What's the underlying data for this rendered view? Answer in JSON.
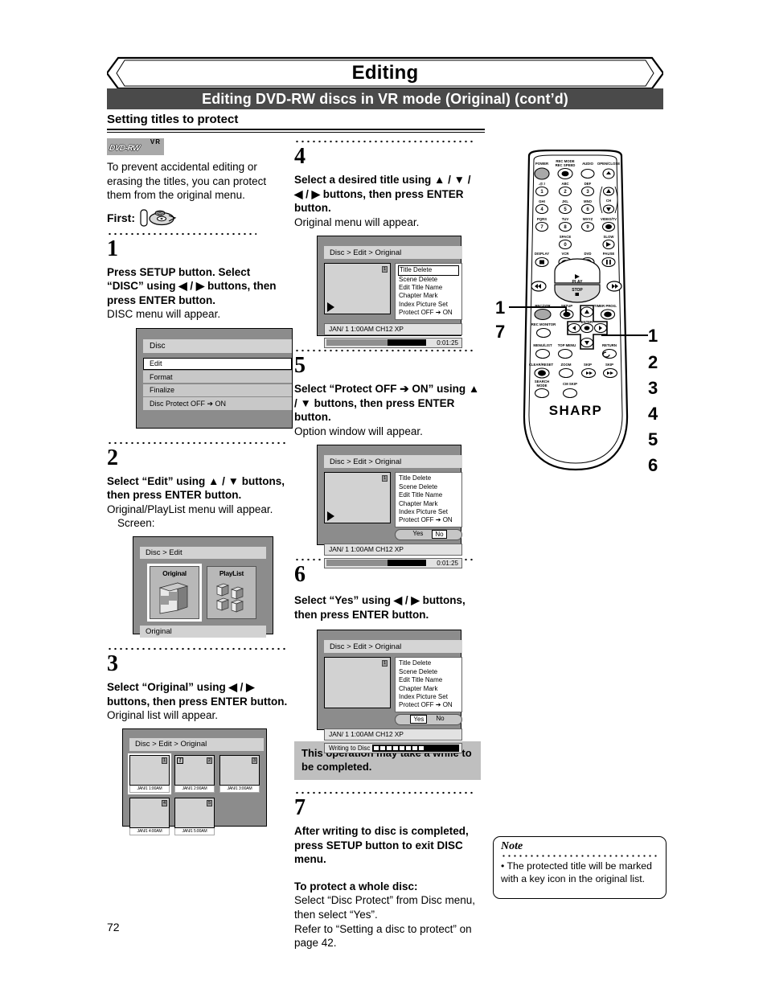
{
  "header": {
    "banner_title": "Editing",
    "sub_banner": "Editing DVD-RW discs in VR mode (Original) (cont’d)",
    "section_title": "Setting titles to protect"
  },
  "page_number": "72",
  "logo": {
    "vr": "VR",
    "disc": "DVD-RW"
  },
  "intro": {
    "paragraph": "To prevent accidental editing or erasing the titles, you can protect them from the original menu.",
    "first_label": "First:",
    "first_icon": "hand-inserting-disc-icon"
  },
  "steps": [
    {
      "number": "1",
      "bold": "Press SETUP button. Select “DISC” using ◀ / ▶ buttons, then press ENTER button.",
      "plain": "DISC menu will appear."
    },
    {
      "number": "2",
      "bold": "Select “Edit” using ▲ / ▼ buttons, then press ENTER button.",
      "plain": "Original/PlayList menu will appear.",
      "plain2": "Screen:"
    },
    {
      "number": "3",
      "bold": "Select “Original” using ◀ / ▶ buttons, then press ENTER button.",
      "plain": "Original list will appear."
    },
    {
      "number": "4",
      "bold": "Select a desired title using ▲ / ▼ / ◀ / ▶ buttons, then press ENTER button.",
      "plain": "Original menu will appear."
    },
    {
      "number": "5",
      "bold": "Select “Protect OFF ➔ ON” using ▲ / ▼ buttons, then press ENTER button.",
      "plain": "Option window will appear."
    },
    {
      "number": "6",
      "bold": "Select “Yes” using ◀ / ▶ buttons, then press ENTER button."
    },
    {
      "number": "7",
      "bold": "After writing to disc is completed, press SETUP button to exit DISC menu."
    }
  ],
  "gray_note": "This operation may take a while to be completed.",
  "whole_disc": {
    "heading": "To protect a whole disc:",
    "body": "Select “Disc Protect” from Disc menu, then select “Yes”.",
    "body2": "Refer to “Setting a disc to protect” on page 42."
  },
  "note": {
    "title": "Note",
    "body": "• The protected title will be marked with a key icon in the original list."
  },
  "disc_menu": {
    "title": "Disc",
    "items": [
      {
        "label": "Edit",
        "selected": true
      },
      {
        "label": "Format",
        "selected": false
      },
      {
        "label": "Finalize",
        "selected": false
      },
      {
        "label": "Disc Protect OFF ➔ ON",
        "selected": false
      }
    ]
  },
  "op_menu": {
    "crumb": "Disc > Edit",
    "cards": [
      {
        "label": "Original",
        "selected": true
      },
      {
        "label": "PlayList",
        "selected": false
      }
    ],
    "footer": "Original"
  },
  "original_list": {
    "crumb": "Disc > Edit > Original",
    "thumbs": [
      {
        "index": "1",
        "label": "JAN/1  1:00AM",
        "selected": true,
        "key": false
      },
      {
        "index": "2",
        "label": "JAN/1  2:00AM",
        "selected": false,
        "key": true
      },
      {
        "index": "3",
        "label": "JAN/1  3:00AM",
        "selected": false,
        "key": false
      },
      {
        "index": "4",
        "label": "JAN/1  4:00AM",
        "selected": false,
        "key": false
      },
      {
        "index": "5",
        "label": "JAN/1  5:00AM",
        "selected": false,
        "key": false
      }
    ]
  },
  "edit_screen": {
    "crumb": "Disc > Edit > Original",
    "thumb_index": "1",
    "options": [
      "Title Delete",
      "Scene Delete",
      "Edit Title Name",
      "Chapter Mark",
      "Index Picture Set",
      "Protect OFF ➔ ON"
    ],
    "info": "JAN/ 1  1:00AM  CH12     XP",
    "time": "0:01:25",
    "yes": "Yes",
    "no": "No",
    "writing": "Writing to Disc"
  },
  "remote": {
    "brand": "SHARP",
    "labels_top": [
      "POWER",
      "REC MODE",
      "REC SPEED",
      "AUDIO",
      "OPEN/CLOSE"
    ],
    "keypad": [
      {
        "letters": ".@:!",
        "digit": "1"
      },
      {
        "letters": "ABC",
        "digit": "2"
      },
      {
        "letters": "DEF",
        "digit": "3"
      },
      {
        "letters": "GHI",
        "digit": "4"
      },
      {
        "letters": "JKL",
        "digit": "5"
      },
      {
        "letters": "MNO",
        "digit": "6"
      },
      {
        "letters": "PQRS",
        "digit": "7"
      },
      {
        "letters": "TUV",
        "digit": "8"
      },
      {
        "letters": "WXYZ",
        "digit": "9"
      },
      {
        "letters": "SPACE",
        "digit": "0"
      }
    ],
    "ch_label": "CH",
    "video_tv": "VIDEO/TV",
    "slow": "SLOW",
    "row_display": [
      "DISPLAY",
      "VCR",
      "DVD",
      "PAUSE"
    ],
    "play": "PLAY",
    "stop": "STOP",
    "row_rec": [
      "REC/OTR",
      "SETUP",
      "TIMER PROG."
    ],
    "row_mon": [
      "REC MONITOR",
      "ENTER",
      "RETURN"
    ],
    "row_menu": [
      "MENU/LIST",
      "TOP MENU"
    ],
    "row_clear": [
      "CLEAR/RESET",
      "ZOOM",
      "SKIP",
      "SKIP"
    ],
    "row_search": [
      "SEARCH MODE",
      "CM SKIP"
    ],
    "callouts_left": [
      "1",
      "7"
    ],
    "callouts_right": [
      "1",
      "2",
      "3",
      "4",
      "5",
      "6"
    ]
  }
}
